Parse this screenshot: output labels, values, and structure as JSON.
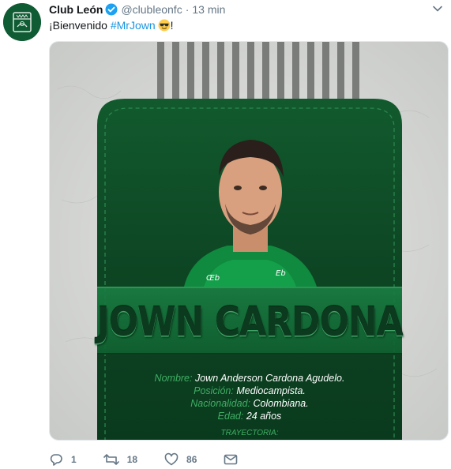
{
  "tweet": {
    "display_name": "Club León",
    "handle": "@clubleonfc",
    "separator": "·",
    "time": "13 min",
    "text_prefix": "¡Bienvenido ",
    "hashtag": "#MrJown",
    "text_suffix": "!"
  },
  "media": {
    "player_name": "JOWN CARDONA",
    "info": [
      {
        "label": "Nombre:",
        "value": "Jown Anderson Cardona Agudelo."
      },
      {
        "label": "Posición:",
        "value": "Mediocampista."
      },
      {
        "label": "Nacionalidad:",
        "value": "Colombiana."
      },
      {
        "label": "Edad:",
        "value": "24 años"
      }
    ],
    "trayectoria": "TRAYECTORIA:",
    "colors": {
      "card_green": "#0f4a26",
      "band_green": "#15723c",
      "bg_gray": "#d9dad8"
    }
  },
  "actions": {
    "reply_count": "1",
    "retweet_count": "18",
    "like_count": "86"
  },
  "icons": [
    "club-logo-icon",
    "verified-icon",
    "caret-down-icon",
    "sunglasses-emoji-icon",
    "reply-icon",
    "retweet-icon",
    "like-icon",
    "message-icon"
  ]
}
